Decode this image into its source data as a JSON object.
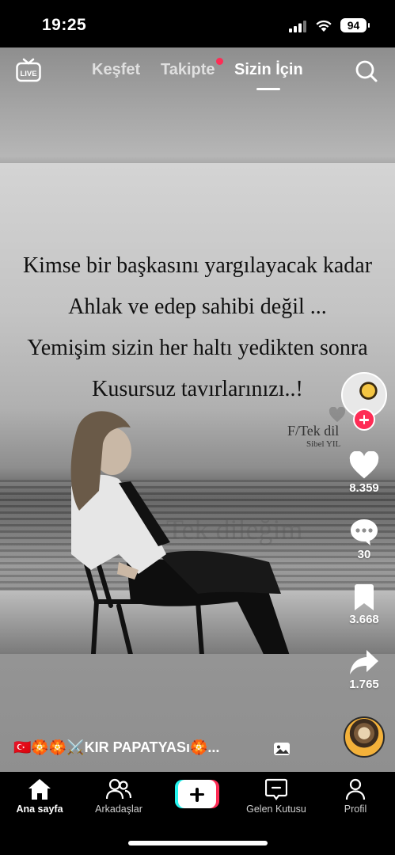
{
  "status_bar": {
    "time": "19:25",
    "battery": "94"
  },
  "top_nav": {
    "tabs": [
      {
        "label": "Keşfet"
      },
      {
        "label": "Takipte"
      },
      {
        "label": "Sizin İçin"
      }
    ],
    "active_tab": "Sizin İçin",
    "live_label": "LIVE"
  },
  "video": {
    "quote_lines": [
      "Kimse bir başkasını yargılayacak kadar",
      "Ahlak ve edep sahibi değil ...",
      "Yemişim sizin her haltı yedikten sonra",
      "Kusursuz tavırlarınızı..!"
    ],
    "signature": "F/Tek dil",
    "signature_sub": "Sibel YIL",
    "watermark": "Tek dileğim"
  },
  "actions": {
    "likes": "8.359",
    "comments": "30",
    "saves": "3.668",
    "shares": "1.765"
  },
  "caption": "🇹🇷🏵️🏵️⚔️KIR PAPATYASı🏵️...",
  "bottom_nav": {
    "items": [
      {
        "label": "Ana sayfa"
      },
      {
        "label": "Arkadaşlar"
      },
      {
        "label": "Gelen Kutusu"
      },
      {
        "label": "Profil"
      }
    ]
  },
  "colors": {
    "accent": "#fe2c55",
    "cyan": "#25f4ee"
  }
}
